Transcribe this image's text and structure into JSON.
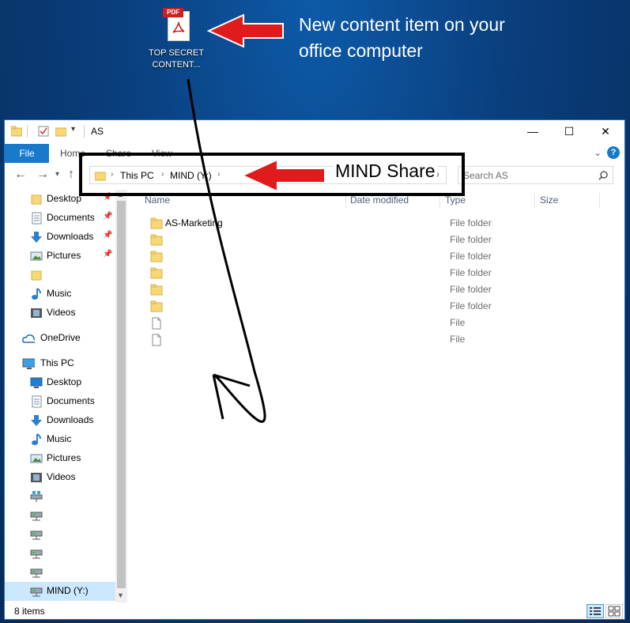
{
  "desktop": {
    "pdf_badge": "PDF",
    "icon_label": "TOP SECRET CONTENT...",
    "annotation": "New content item on your office computer"
  },
  "window": {
    "title": "AS",
    "tabs": {
      "file": "File",
      "home": "Home",
      "share": "Share",
      "view": "View"
    },
    "help": "?",
    "controls": {
      "minimize": "—",
      "maximize": "☐",
      "close": "✕"
    }
  },
  "address": {
    "crumbs": [
      "This PC",
      "MIND (Y:)"
    ],
    "callout": "MIND Share"
  },
  "search": {
    "placeholder": "Search AS"
  },
  "sidebar": {
    "quick_access": [
      {
        "label": "Desktop",
        "pinned": true
      },
      {
        "label": "Documents",
        "pinned": true
      },
      {
        "label": "Downloads",
        "pinned": true
      },
      {
        "label": "Pictures",
        "pinned": true
      },
      {
        "label": ""
      },
      {
        "label": "Music"
      },
      {
        "label": "Videos"
      }
    ],
    "onedrive": "OneDrive",
    "this_pc": "This PC",
    "this_pc_items": [
      "Desktop",
      "Documents",
      "Downloads",
      "Music",
      "Pictures",
      "Videos"
    ],
    "drives": [
      "",
      "",
      "",
      "",
      "",
      "MIND (Y:)"
    ]
  },
  "columns": {
    "name": "Name",
    "date": "Date modified",
    "type": "Type",
    "size": "Size"
  },
  "files": [
    {
      "name": "AS-Marketing",
      "type": "File folder",
      "kind": "folder"
    },
    {
      "name": "",
      "type": "File folder",
      "kind": "folder"
    },
    {
      "name": "",
      "type": "File folder",
      "kind": "folder"
    },
    {
      "name": "",
      "type": "File folder",
      "kind": "folder"
    },
    {
      "name": "",
      "type": "File folder",
      "kind": "folder"
    },
    {
      "name": "",
      "type": "File folder",
      "kind": "folder"
    },
    {
      "name": "",
      "type": "File",
      "kind": "file"
    },
    {
      "name": "",
      "type": "File",
      "kind": "file"
    }
  ],
  "status": {
    "count": "8 items"
  },
  "colors": {
    "accent": "#1979ca",
    "arrow": "#e01b1b",
    "folder": "#f8d775",
    "selected": "#cce8ff"
  }
}
